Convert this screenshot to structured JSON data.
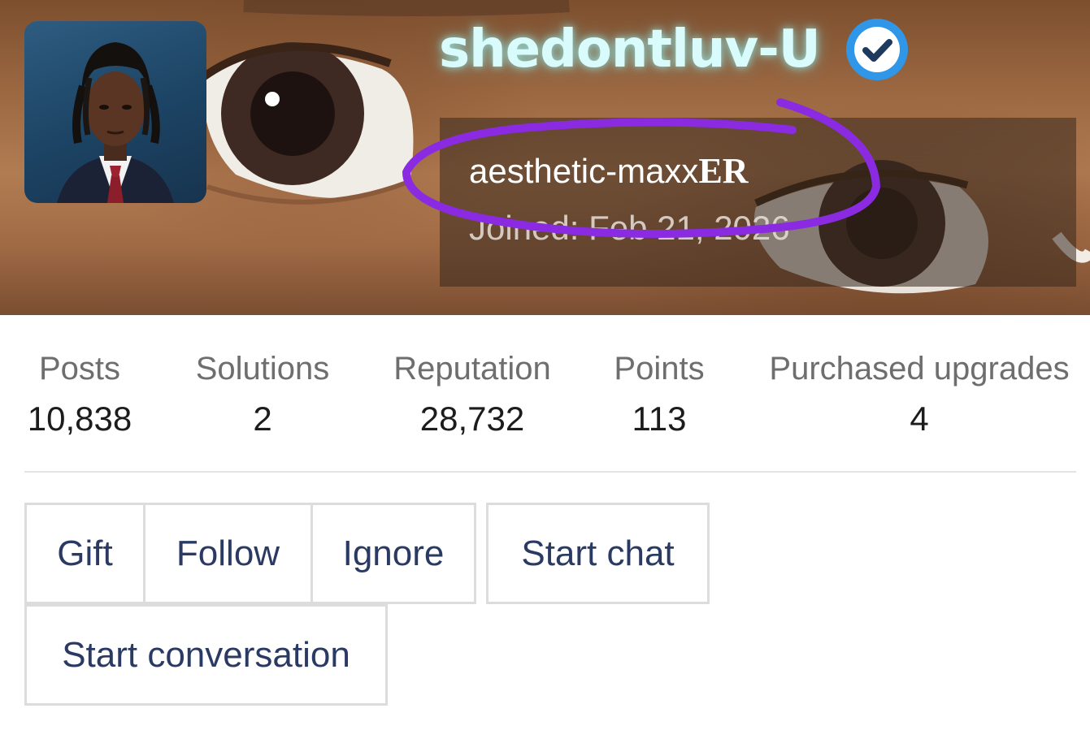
{
  "profile": {
    "username": "shedontluv-U",
    "verified_icon": "verified-check-icon",
    "user_title_main": "aesthetic-maxx",
    "user_title_suffix": "ER",
    "joined": "Joined: Feb 21, 2026",
    "username_color": "#d9fbfb",
    "verified_color": "#2f96e8",
    "scribble_color": "#8a2be2"
  },
  "stats": [
    {
      "label": "Posts",
      "value": "10,838"
    },
    {
      "label": "Solutions",
      "value": "2"
    },
    {
      "label": "Reputation",
      "value": "28,732"
    },
    {
      "label": "Points",
      "value": "113"
    },
    {
      "label": "Purchased upgrades",
      "value": "4"
    }
  ],
  "actions": {
    "gift": "Gift",
    "follow": "Follow",
    "ignore": "Ignore",
    "start_chat": "Start chat",
    "start_conversation": "Start conversation"
  }
}
